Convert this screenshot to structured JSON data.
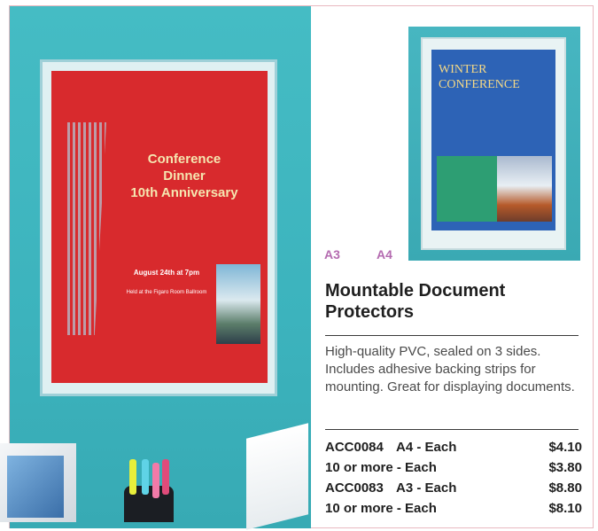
{
  "product": {
    "title_line1": "Mountable Document",
    "title_line2": "Protectors",
    "description": "High-quality PVC, sealed on 3 sides. Includes adhesive backing strips for mounting. Great for displaying documents.",
    "size_labels": [
      "A3",
      "A4"
    ]
  },
  "pricing": [
    {
      "code": "ACC0084",
      "desc": "A4 - Each",
      "price": "$4.10"
    },
    {
      "code": "10 or more - Each",
      "desc": "",
      "price": "$3.80"
    },
    {
      "code": "ACC0083",
      "desc": "A3 - Each",
      "price": "$8.80"
    },
    {
      "code": "10 or more - Each",
      "desc": "",
      "price": "$8.10"
    }
  ],
  "poster_a3": {
    "title_lines": [
      "Conference",
      "Dinner",
      "10th Anniversary"
    ],
    "date": "August 24th at 7pm",
    "venue": "Held at the Figaro Room Ballroom"
  },
  "poster_a4": {
    "title_lines": [
      "WINTER",
      "CONFERENCE"
    ]
  },
  "colors": {
    "accent_label": "#b46bb0",
    "wall": "#45bcc4",
    "poster_red": "#d82a2d",
    "poster_blue": "#2d63b6"
  }
}
